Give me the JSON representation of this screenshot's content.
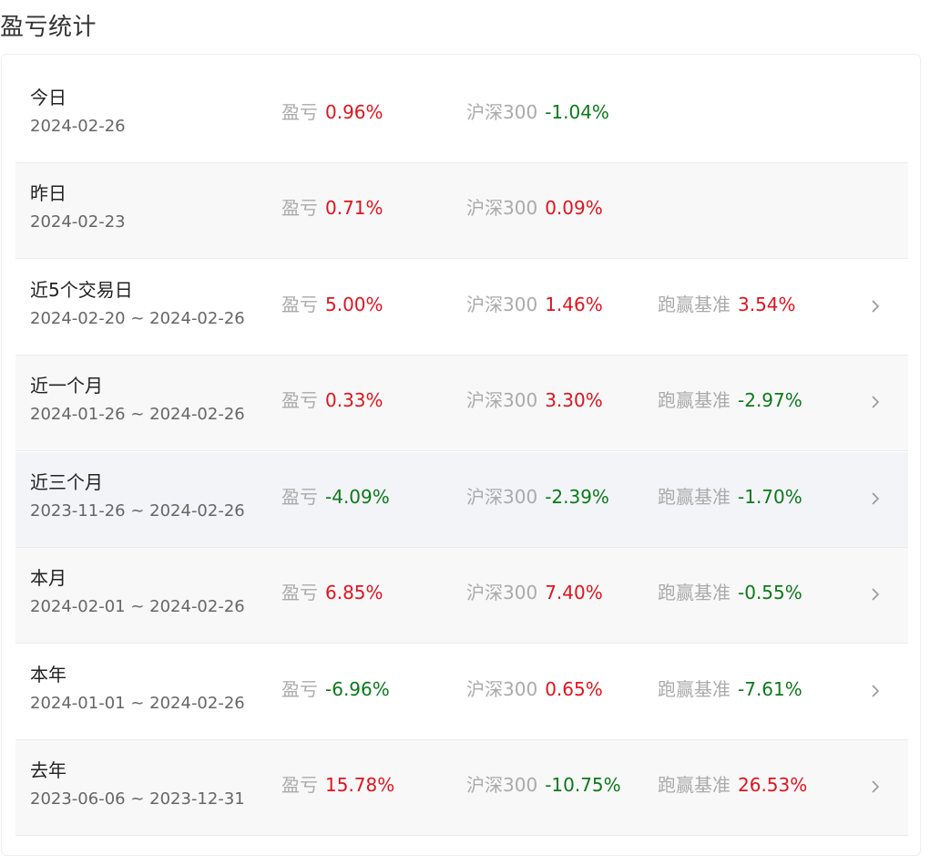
{
  "title": "盈亏统计",
  "labels": {
    "pl": "盈亏",
    "index": "沪深300",
    "excess": "跑赢基准"
  },
  "colors": {
    "positive": "#e0141e",
    "negative": "#0b7a19"
  },
  "rows": [
    {
      "name": "今日",
      "date": "2024-02-26",
      "pl": "0.96%",
      "index": "-1.04%",
      "excess": null
    },
    {
      "name": "昨日",
      "date": "2024-02-23",
      "pl": "0.71%",
      "index": "0.09%",
      "excess": null
    },
    {
      "name": "近5个交易日",
      "date": "2024-02-20 ~ 2024-02-26",
      "pl": "5.00%",
      "index": "1.46%",
      "excess": "3.54%"
    },
    {
      "name": "近一个月",
      "date": "2024-01-26 ~ 2024-02-26",
      "pl": "0.33%",
      "index": "3.30%",
      "excess": "-2.97%"
    },
    {
      "name": "近三个月",
      "date": "2023-11-26 ~ 2024-02-26",
      "pl": "-4.09%",
      "index": "-2.39%",
      "excess": "-1.70%"
    },
    {
      "name": "本月",
      "date": "2024-02-01 ~ 2024-02-26",
      "pl": "6.85%",
      "index": "7.40%",
      "excess": "-0.55%"
    },
    {
      "name": "本年",
      "date": "2024-01-01 ~ 2024-02-26",
      "pl": "-6.96%",
      "index": "0.65%",
      "excess": "-7.61%"
    },
    {
      "name": "去年",
      "date": "2023-06-06 ~ 2023-12-31",
      "pl": "15.78%",
      "index": "-10.75%",
      "excess": "26.53%"
    }
  ]
}
